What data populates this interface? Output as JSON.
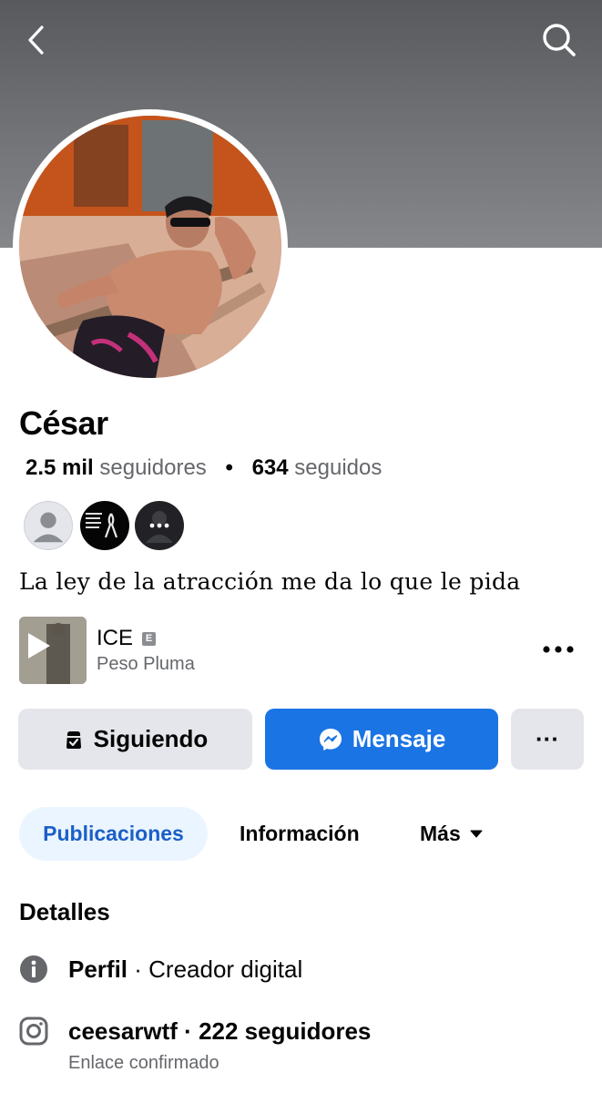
{
  "header": {
    "back_icon": "chevron-left-icon",
    "search_icon": "search-icon"
  },
  "profile": {
    "name": "César",
    "followers_count": "2.5 mil",
    "followers_label": "seguidores",
    "separator": "•",
    "following_count": "634",
    "following_label": "seguidos",
    "bio": "La ley de la atracción me da lo que le pida"
  },
  "mutual_friends": [
    {
      "icon": "default-avatar-icon"
    },
    {
      "icon": "memorial-ribbon-avatar"
    },
    {
      "icon": "more-friends-icon"
    }
  ],
  "music": {
    "title": "ICE",
    "explicit_badge": "E",
    "artist": "Peso Pluma",
    "play_icon": "play-icon",
    "more_icon": "more-dots-icon"
  },
  "actions": {
    "follow_label": "Siguiendo",
    "follow_icon": "following-check-icon",
    "message_label": "Mensaje",
    "message_icon": "messenger-icon",
    "more_label": "···"
  },
  "tabs": [
    {
      "label": "Publicaciones",
      "active": true
    },
    {
      "label": "Información",
      "active": false
    },
    {
      "label": "Más",
      "active": false
    }
  ],
  "details": {
    "title": "Detalles",
    "profile_label": "Perfil",
    "profile_value": " · Creador digital",
    "instagram_text": "ceesarwtf · 222 seguidores",
    "instagram_sub": "Enlace confirmado"
  },
  "colors": {
    "accent_blue": "#1b74e4",
    "active_tab_bg": "#ebf5ff",
    "secondary_text": "#65676b",
    "button_grey": "#e4e6eb"
  }
}
